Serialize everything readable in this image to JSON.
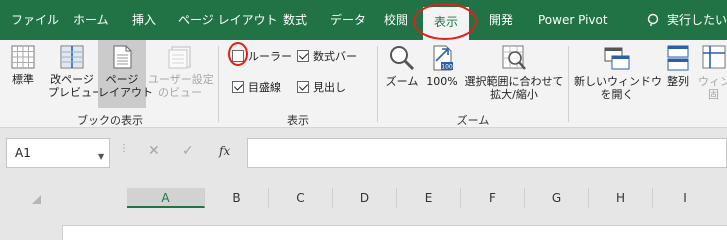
{
  "tabs": [
    {
      "label": "ファイル"
    },
    {
      "label": "ホーム"
    },
    {
      "label": "挿入"
    },
    {
      "label": "ページ レイアウト"
    },
    {
      "label": "数式"
    },
    {
      "label": "データ"
    },
    {
      "label": "校閲"
    },
    {
      "label": "表示",
      "active": true
    },
    {
      "label": "開発"
    },
    {
      "label": "Power Pivot"
    },
    {
      "label": "実行したい作業"
    }
  ],
  "ribbon": {
    "workbook_views": {
      "group_label": "ブックの表示",
      "normal": "標準",
      "page_break_1": "改ページ",
      "page_break_2": "プレビュー",
      "page_layout_1": "ページ",
      "page_layout_2": "レイアウト",
      "custom_1": "ユーザー設定",
      "custom_2": "のビュー"
    },
    "show": {
      "group_label": "表示",
      "ruler": {
        "label": "ルーラー",
        "checked": false
      },
      "formula_bar": {
        "label": "数式バー",
        "checked": true
      },
      "gridlines": {
        "label": "目盛線",
        "checked": true
      },
      "headings": {
        "label": "見出し",
        "checked": true
      }
    },
    "zoom": {
      "group_label": "ズーム",
      "zoom": "ズーム",
      "hundred": "100%",
      "fit_1": "選択範囲に合わせて",
      "fit_2": "拡大/縮小"
    },
    "window": {
      "new_window_1": "新しいウィンドウ",
      "new_window_2": "を開く",
      "arrange": "整列",
      "freeze_1": "ウィン",
      "freeze_2": "固"
    }
  },
  "formula_bar": {
    "name_box": "A1",
    "fx": "fx",
    "value": ""
  },
  "columns": [
    "A",
    "B",
    "C",
    "D",
    "E",
    "F",
    "G",
    "H",
    "I"
  ],
  "selected_column": "A",
  "colors": {
    "accent": "#217346",
    "highlight": "#e0201b"
  }
}
